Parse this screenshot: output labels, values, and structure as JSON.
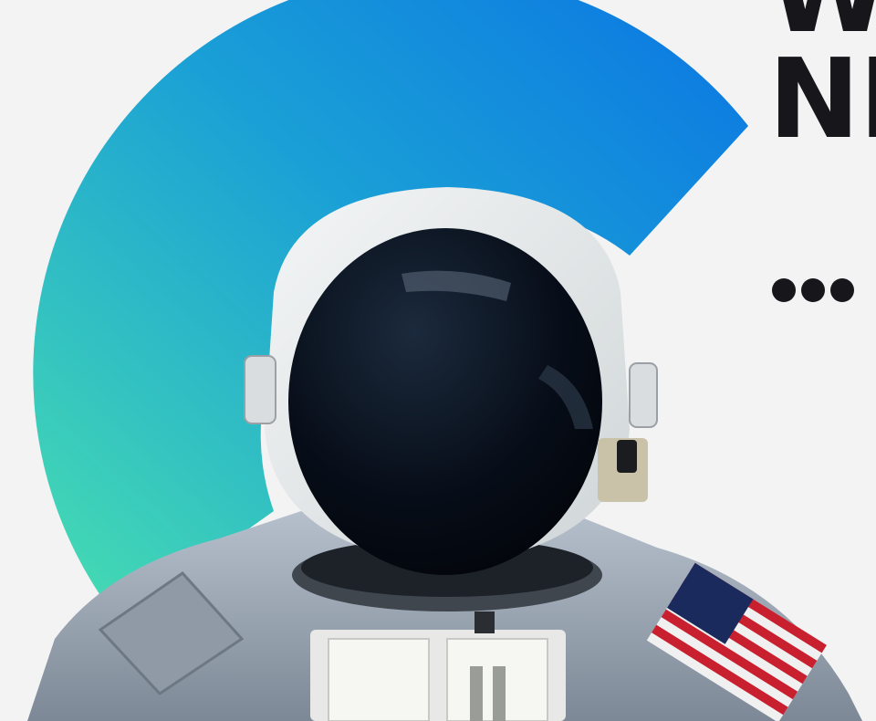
{
  "hero": {
    "headline_line1": "W",
    "headline_line2": "NE",
    "more_glyph": "more-dots-icon",
    "accent_gradient": [
      "#48dfb0",
      "#0a74e4"
    ],
    "image": "astronaut-photo"
  }
}
